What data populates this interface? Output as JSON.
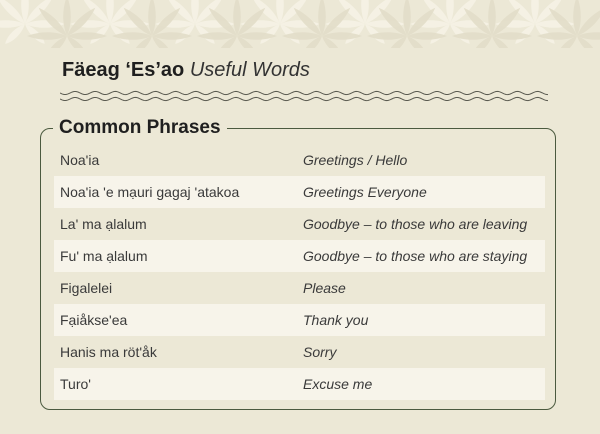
{
  "page": {
    "title_bold": "Fäeag ‘Es’ao",
    "title_italic": "Useful Words"
  },
  "section": {
    "title": "Common Phrases",
    "rows": [
      {
        "term": "Noa'ia",
        "meaning": "Greetings / Hello"
      },
      {
        "term": "Noa'ia 'e mạuri gagaj 'atakoa",
        "meaning": "Greetings Everyone"
      },
      {
        "term": "La' ma ạlalum",
        "meaning": "Goodbye – to those who are leaving"
      },
      {
        "term": "Fu' ma ạlalum",
        "meaning": "Goodbye – to those who are staying"
      },
      {
        "term": "Figalelei",
        "meaning": "Please"
      },
      {
        "term": "Fạiåkse'ea",
        "meaning": "Thank you"
      },
      {
        "term": "Hanis ma röt'åk",
        "meaning": "Sorry"
      },
      {
        "term": "Turo'",
        "meaning": "Excuse me"
      }
    ]
  },
  "colors": {
    "background": "#ece8d6",
    "row_alt": "#f7f4ea",
    "border": "#4b5a3f",
    "motif": "#f6f3e6"
  },
  "decor": {
    "banner_icon": "frangipani-flower-pattern",
    "divider_icon": "wave-divider"
  }
}
